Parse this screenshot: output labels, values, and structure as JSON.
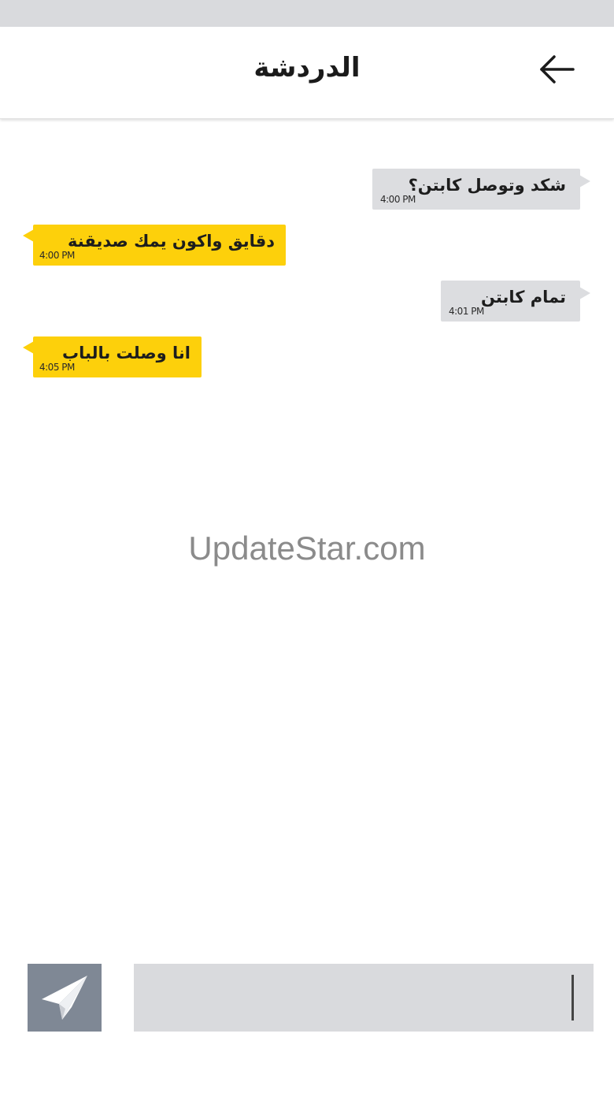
{
  "header": {
    "title": "الدردشة",
    "back_icon": "arrow-left-icon"
  },
  "messages": [
    {
      "direction": "incoming",
      "text": "شكد وتوصل كابتن؟",
      "time": "4:00 PM"
    },
    {
      "direction": "outgoing",
      "text": "دقايق واكون يمك صديقنة",
      "time": "4:00 PM"
    },
    {
      "direction": "incoming",
      "text": "تمام كابتن",
      "time": "4:01 PM"
    },
    {
      "direction": "outgoing",
      "text": "انا وصلت بالباب",
      "time": "4:05 PM"
    }
  ],
  "watermark": "UpdateStar.com",
  "composer": {
    "value": "",
    "placeholder": "",
    "send_icon": "paper-plane-icon"
  },
  "colors": {
    "outgoing_bubble": "#fdd00b",
    "incoming_bubble": "#dcdde0",
    "send_button": "#7f8895"
  }
}
